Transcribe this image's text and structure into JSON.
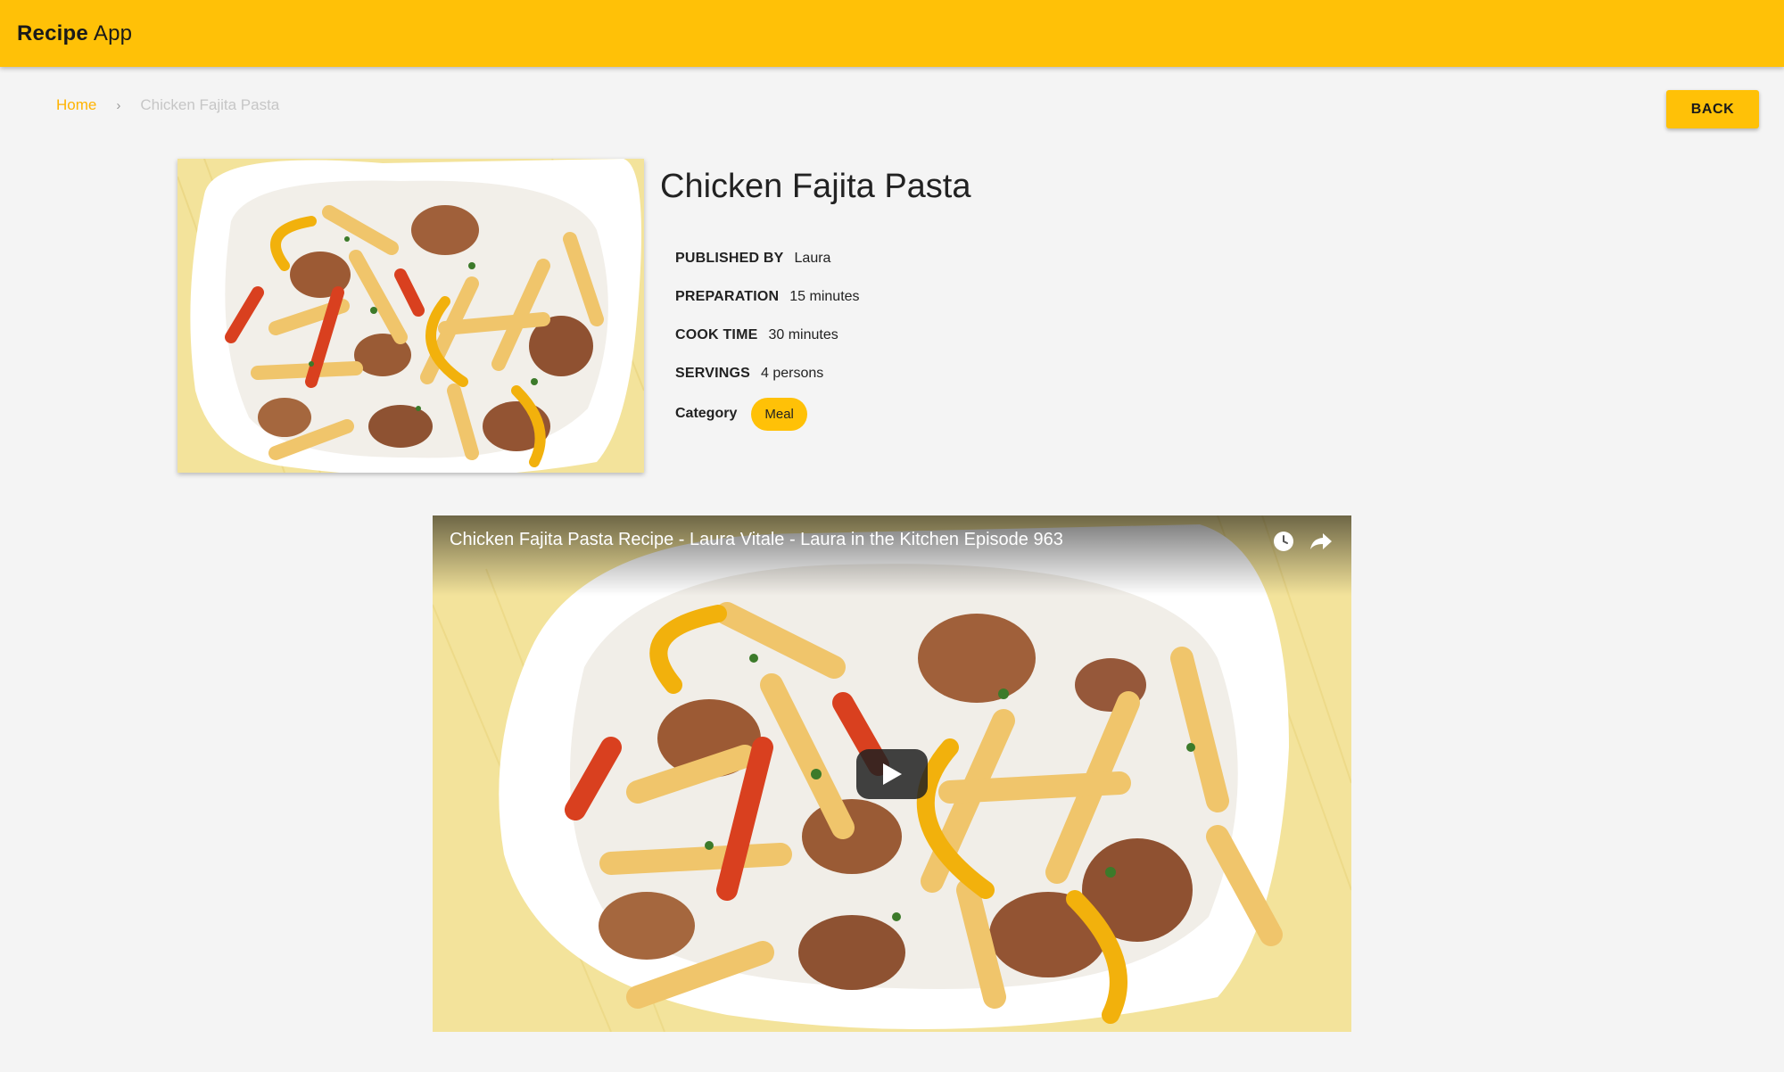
{
  "app": {
    "brand_bold": "Recipe",
    "brand_light": "App"
  },
  "breadcrumb": {
    "home": "Home",
    "separator": "›",
    "current": "Chicken Fajita Pasta"
  },
  "toolbar": {
    "back_label": "BACK"
  },
  "recipe": {
    "title": "Chicken Fajita Pasta",
    "published_by_label": "PUBLISHED BY",
    "published_by": "Laura",
    "preparation_label": "PREPARATION",
    "preparation": "15 minutes",
    "cook_time_label": "COOK TIME",
    "cook_time": "30 minutes",
    "servings_label": "SERVINGS",
    "servings": "4 persons",
    "category_label": "Category",
    "category": "Meal"
  },
  "video": {
    "title": "Chicken Fajita Pasta Recipe - Laura Vitale - Laura in the Kitchen Episode 963",
    "icons": [
      "clock-icon",
      "share-icon",
      "play-icon"
    ]
  },
  "colors": {
    "accent": "#ffc107",
    "link": "#ffb300",
    "background": "#f4f4f4"
  }
}
